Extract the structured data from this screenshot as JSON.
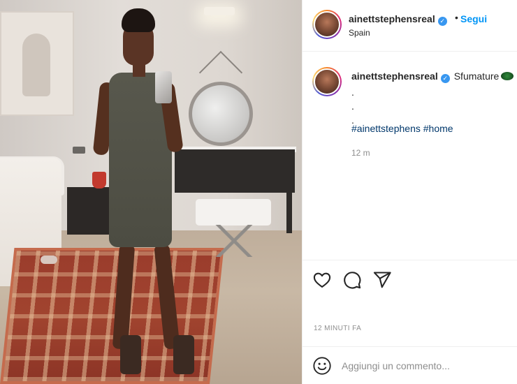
{
  "post": {
    "image": "photo-room-selfie",
    "header": {
      "username": "ainettstephensreal",
      "separator": "•",
      "follow_label": "Segui",
      "location": "Spain"
    },
    "caption": {
      "username": "ainettstephensreal",
      "text": "Sfumature",
      "emoji": "green-heart-emoji",
      "dots": [
        ".",
        ".",
        "."
      ],
      "hashtags": [
        "#ainettstephens",
        "#home"
      ],
      "time": "12 m"
    },
    "actions": {
      "icons": [
        "heart-icon",
        "comment-icon",
        "share-icon"
      ]
    },
    "timestamp": "12 MINUTI FA",
    "comment": {
      "placeholder": "Aggiungi un commento..."
    }
  },
  "colors": {
    "follow": "#0095f6",
    "verified": "#3897f0",
    "hashtag": "#00376b",
    "muted": "#8e8e8e"
  }
}
